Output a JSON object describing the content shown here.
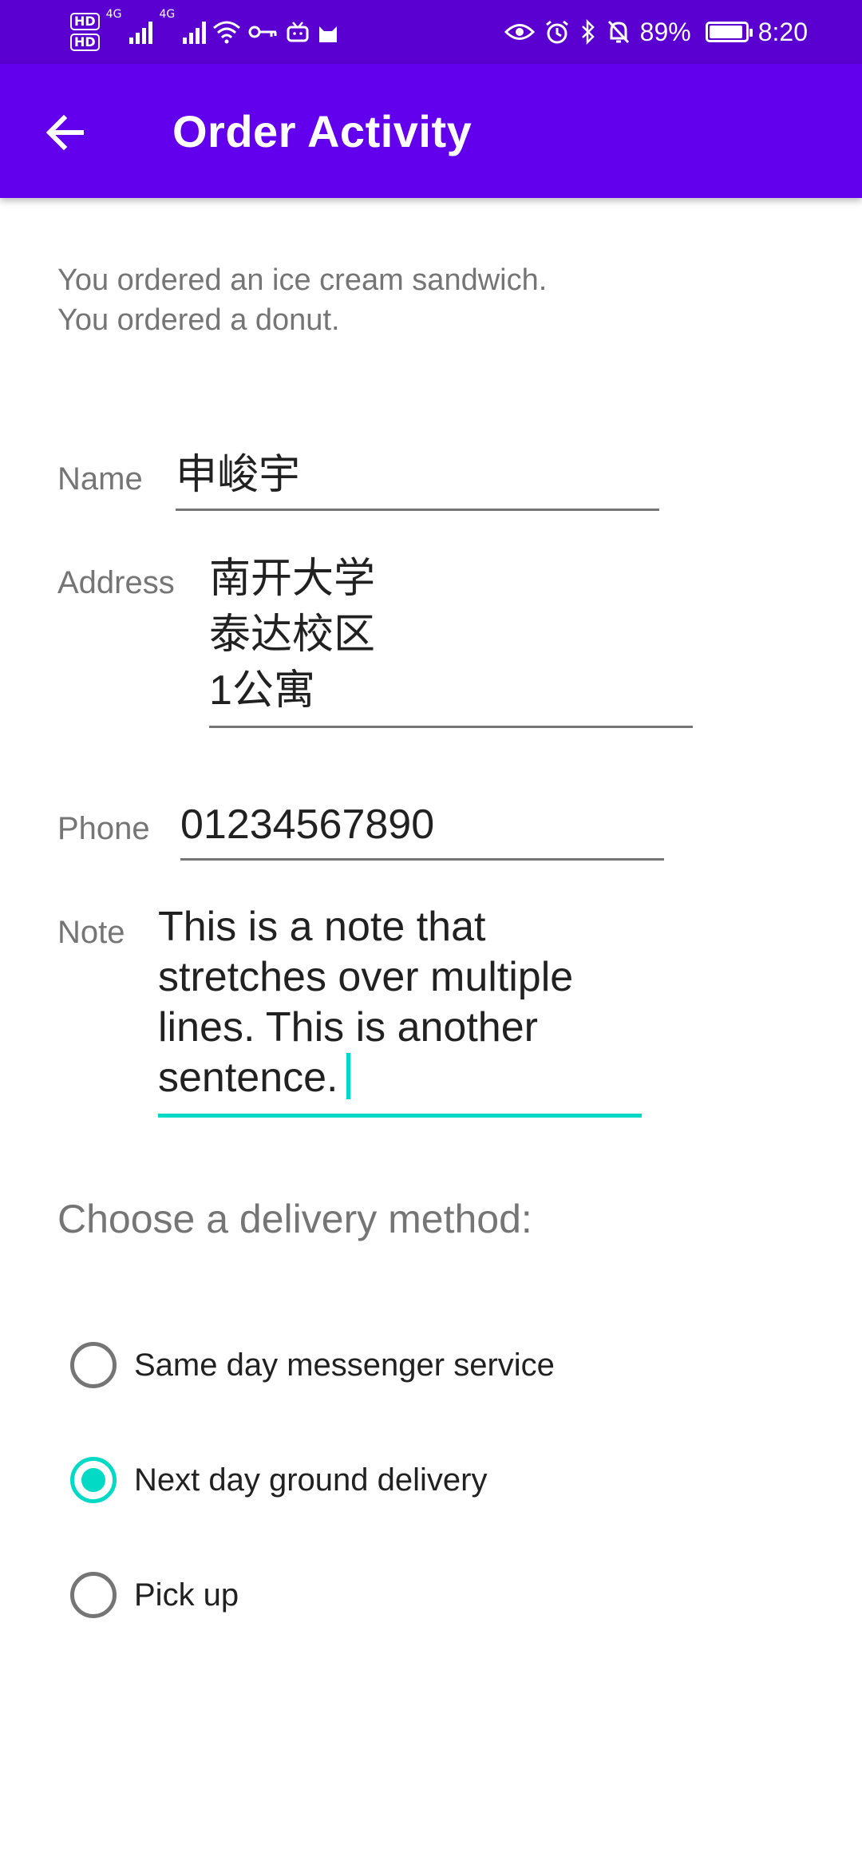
{
  "status_bar": {
    "hd1": "HD",
    "hd2": "HD",
    "net1": "4G",
    "net2": "4G",
    "battery": "89%",
    "time": "8:20"
  },
  "app_bar": {
    "title": "Order Activity"
  },
  "order": {
    "line1": "You ordered an ice cream sandwich.",
    "line2": "You ordered a donut."
  },
  "form": {
    "name_label": "Name",
    "name_value": "申峻宇",
    "address_label": "Address",
    "address_lines": [
      "南开大学",
      "泰达校区",
      "1公寓"
    ],
    "phone_label": "Phone",
    "phone_value": "01234567890",
    "note_label": "Note",
    "note_lines": [
      "This is a note that",
      "stretches over multiple",
      "lines. This is another",
      "sentence."
    ]
  },
  "delivery": {
    "heading": "Choose a delivery method:",
    "options": [
      {
        "label": "Same day messenger service",
        "checked": false
      },
      {
        "label": "Next day ground delivery",
        "checked": true
      },
      {
        "label": "Pick up",
        "checked": false
      }
    ]
  },
  "colors": {
    "status_bar": "#5a00d1",
    "app_bar": "#6200ee",
    "accent": "#03dac5"
  }
}
